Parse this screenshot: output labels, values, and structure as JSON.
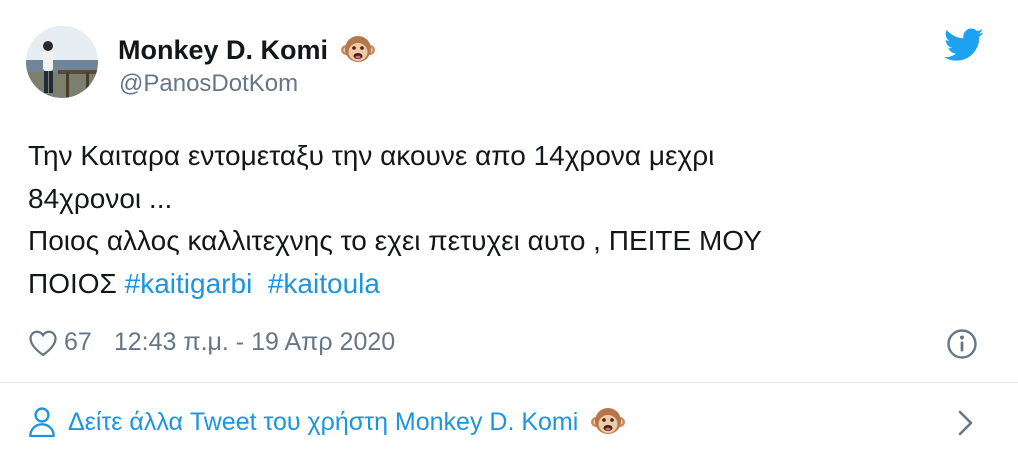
{
  "tweet": {
    "author_name": "Monkey D. Komi",
    "author_handle": "@PanosDotKom",
    "text_lines": [
      "Την Καιταρα εντομεταξυ την ακουνε απο 14χρονα μεχρι",
      "84χρονοι ...",
      "Ποιος αλλος καλλιτεχνης το εχει πετυχει αυτο , ΠΕΙΤΕ ΜΟΥ"
    ],
    "last_line_prefix": "ΠΟΙΟΣ",
    "hashtags": [
      "#kaitigarbi",
      "#kaitoula"
    ],
    "likes": "67",
    "timestamp": "12:43 π.μ. - 19 Απρ 2020"
  },
  "footer": {
    "see_more_label": "Δείτε άλλα Tweet του χρήστη Monkey D. Komi"
  },
  "icons": {
    "brand": "twitter-bird-icon",
    "emoji": "monkey-face-emoji",
    "like": "heart-icon",
    "info": "info-icon",
    "profile": "person-icon",
    "more": "chevron-right-icon"
  },
  "colors": {
    "text": "#14171a",
    "secondary": "#657786",
    "link": "#1b95e0",
    "divider": "#e1e8ed"
  }
}
